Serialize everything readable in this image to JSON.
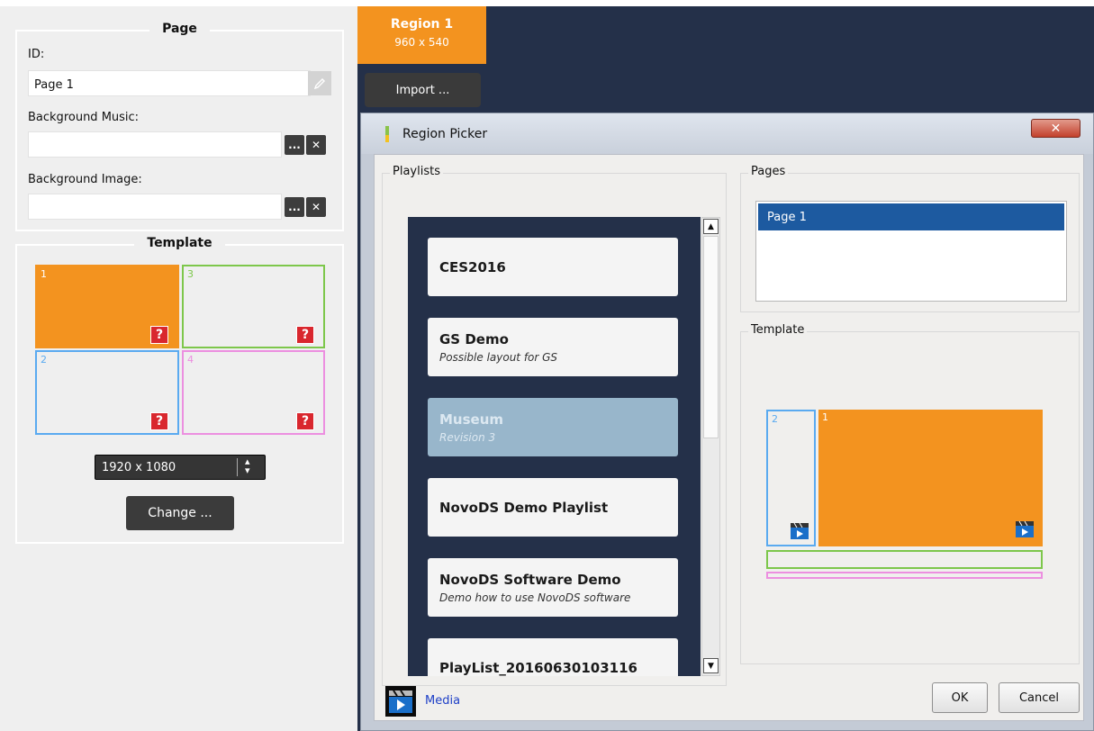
{
  "page_section": {
    "title": "Page",
    "id_label": "ID:",
    "id_value": "Page 1",
    "music_label": "Background Music:",
    "music_value": "",
    "image_label": "Background Image:",
    "image_value": "",
    "browse_label": "...",
    "clear_label": "✕"
  },
  "template_section": {
    "title": "Template",
    "tiles": [
      {
        "number": "1",
        "badge": "?",
        "color": "#f3931f"
      },
      {
        "number": "3",
        "badge": "?",
        "color": "#7dc74b"
      },
      {
        "number": "2",
        "badge": "?",
        "color": "#5aaaf0"
      },
      {
        "number": "4",
        "badge": "?",
        "color": "#ec8fe0"
      }
    ],
    "resolution": "1920 x 1080",
    "change_button": "Change ..."
  },
  "region_tab": {
    "name": "Region 1",
    "size": "960 x 540"
  },
  "import_button": "Import ...",
  "dialog": {
    "title": "Region Picker",
    "close_label": "✕",
    "playlists_label": "Playlists",
    "playlists": [
      {
        "name": "CES2016",
        "description": ""
      },
      {
        "name": "GS Demo",
        "description": "Possible layout for GS"
      },
      {
        "name": "Museum",
        "description": "Revision 3",
        "selected": true
      },
      {
        "name": "NovoDS Demo Playlist",
        "description": ""
      },
      {
        "name": "NovoDS Software Demo",
        "description": "Demo how to use NovoDS software"
      },
      {
        "name": "PlayList_20160630103116",
        "description": ""
      }
    ],
    "pages_label": "Pages",
    "pages": [
      "Page 1"
    ],
    "template_label": "Template",
    "template_tiles": [
      {
        "number": "2",
        "color": "#5aaaf0"
      },
      {
        "number": "1",
        "color": "#f3931f"
      }
    ],
    "media_label": "Media",
    "ok_button": "OK",
    "cancel_button": "Cancel"
  },
  "colors": {
    "orange": "#f3931f",
    "navy": "#243049",
    "selection_blue": "#1d5aa0"
  }
}
